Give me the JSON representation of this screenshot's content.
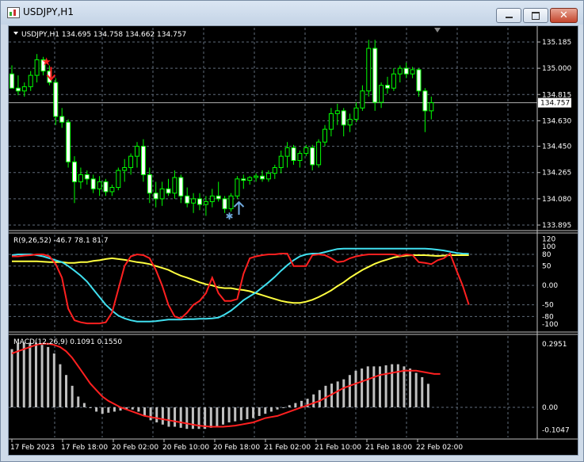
{
  "window": {
    "title": "USDJPY,H1"
  },
  "colors": {
    "bull": "#00ff00",
    "bear": "#00ff00",
    "grid": "#5f6b7a",
    "rsi_red": "#ff2020",
    "rsi_cyan": "#40e0f0",
    "rsi_yellow": "#ffff40",
    "macd_bar": "#c0c0c0",
    "macd_signal": "#ff2020",
    "arrow_sell": "#ff2020",
    "arrow_buy": "#6fa8dc",
    "price_tag_bg": "#ffffff"
  },
  "main_chart": {
    "header": "USDJPY,H1  134.695 134.758 134.662 134.757",
    "current_price": "134.757",
    "price_axis": [
      "135.185",
      "135.000",
      "134.815",
      "134.630",
      "134.450",
      "134.265",
      "134.080",
      "133.895"
    ],
    "price_range": [
      133.895,
      135.185
    ],
    "candles": [
      [
        134.96,
        135.02,
        134.9,
        134.86
      ],
      [
        134.86,
        134.95,
        134.81,
        134.84
      ],
      [
        134.84,
        134.9,
        134.8,
        134.87
      ],
      [
        134.87,
        134.98,
        134.84,
        134.95
      ],
      [
        134.95,
        135.1,
        134.9,
        135.06
      ],
      [
        135.06,
        135.08,
        134.95,
        134.98
      ],
      [
        134.98,
        135.02,
        134.88,
        134.9
      ],
      [
        134.9,
        134.93,
        134.6,
        134.66
      ],
      [
        134.66,
        134.72,
        134.58,
        134.62
      ],
      [
        134.62,
        134.64,
        134.3,
        134.34
      ],
      [
        134.34,
        134.38,
        134.05,
        134.2
      ],
      [
        134.2,
        134.3,
        134.15,
        134.25
      ],
      [
        134.25,
        134.28,
        134.18,
        134.22
      ],
      [
        134.22,
        134.25,
        134.12,
        134.15
      ],
      [
        134.15,
        134.24,
        134.1,
        134.2
      ],
      [
        134.2,
        134.22,
        134.1,
        134.13
      ],
      [
        134.13,
        134.18,
        134.1,
        134.16
      ],
      [
        134.16,
        134.3,
        134.14,
        134.28
      ],
      [
        134.28,
        134.36,
        134.2,
        134.3
      ],
      [
        134.3,
        134.4,
        134.25,
        134.38
      ],
      [
        134.38,
        134.48,
        134.3,
        134.45
      ],
      [
        134.45,
        134.5,
        134.2,
        134.25
      ],
      [
        134.25,
        134.3,
        134.05,
        134.12
      ],
      [
        134.12,
        134.2,
        134.02,
        134.08
      ],
      [
        134.08,
        134.2,
        134.03,
        134.15
      ],
      [
        134.15,
        134.22,
        134.1,
        134.12
      ],
      [
        134.12,
        134.28,
        134.08,
        134.23
      ],
      [
        134.23,
        134.25,
        134.05,
        134.1
      ],
      [
        134.1,
        134.16,
        134.02,
        134.05
      ],
      [
        134.05,
        134.12,
        133.98,
        134.08
      ],
      [
        134.08,
        134.12,
        134.0,
        134.04
      ],
      [
        134.04,
        134.1,
        133.96,
        134.06
      ],
      [
        134.06,
        134.15,
        134.02,
        134.1
      ],
      [
        134.1,
        134.2,
        134.06,
        134.08
      ],
      [
        134.08,
        134.1,
        133.98,
        134.01
      ],
      [
        134.01,
        134.12,
        133.99,
        134.1
      ],
      [
        134.1,
        134.24,
        134.08,
        134.22
      ],
      [
        134.22,
        134.25,
        134.15,
        134.21
      ],
      [
        134.21,
        134.24,
        134.18,
        134.23
      ],
      [
        134.23,
        134.26,
        134.2,
        134.24
      ],
      [
        134.24,
        134.28,
        134.2,
        134.22
      ],
      [
        134.22,
        134.28,
        134.2,
        134.26
      ],
      [
        134.26,
        134.32,
        134.22,
        134.3
      ],
      [
        134.3,
        134.42,
        134.26,
        134.38
      ],
      [
        134.38,
        134.48,
        134.3,
        134.44
      ],
      [
        134.44,
        134.46,
        134.32,
        134.35
      ],
      [
        134.35,
        134.42,
        134.3,
        134.4
      ],
      [
        134.4,
        134.46,
        134.38,
        134.44
      ],
      [
        134.44,
        134.46,
        134.28,
        134.32
      ],
      [
        134.32,
        134.5,
        134.3,
        134.48
      ],
      [
        134.48,
        134.6,
        134.45,
        134.57
      ],
      [
        134.57,
        134.72,
        134.52,
        134.68
      ],
      [
        134.68,
        134.75,
        134.6,
        134.7
      ],
      [
        134.7,
        134.72,
        134.52,
        134.6
      ],
      [
        134.6,
        134.68,
        134.55,
        134.64
      ],
      [
        134.64,
        134.76,
        134.62,
        134.72
      ],
      [
        134.72,
        134.88,
        134.7,
        134.84
      ],
      [
        134.84,
        135.2,
        134.8,
        135.14
      ],
      [
        135.14,
        135.2,
        134.7,
        134.76
      ],
      [
        134.76,
        134.9,
        134.72,
        134.88
      ],
      [
        134.88,
        134.94,
        134.82,
        134.86
      ],
      [
        134.86,
        135.0,
        134.84,
        134.96
      ],
      [
        134.96,
        135.02,
        134.9,
        135.0
      ],
      [
        135.0,
        135.04,
        134.93,
        134.96
      ],
      [
        134.96,
        135.01,
        134.93,
        134.99
      ],
      [
        134.99,
        135.0,
        134.8,
        134.84
      ],
      [
        134.84,
        134.86,
        134.55,
        134.7
      ],
      [
        134.7,
        134.8,
        134.64,
        134.757
      ]
    ],
    "sell_markers": [
      6
    ],
    "buy_markers": [
      35
    ],
    "time_axis": [
      "17 Feb 2023",
      "17 Feb 18:00",
      "20 Feb 02:00",
      "20 Feb 10:00",
      "20 Feb 18:00",
      "21 Feb 02:00",
      "21 Feb 10:00",
      "21 Feb 18:00",
      "22 Feb 02:00"
    ]
  },
  "rsi_panel": {
    "header": "R(9,26,52) -46.7 78.1 81.7",
    "axis": [
      "120",
      "100",
      "80",
      "50",
      "0.00",
      "-50",
      "-80",
      "-100"
    ],
    "range": [
      -110,
      125
    ],
    "red": [
      75,
      75,
      77,
      78,
      80,
      80,
      75,
      55,
      20,
      -60,
      -90,
      -95,
      -98,
      -98,
      -98,
      -95,
      -70,
      -10,
      50,
      75,
      80,
      78,
      70,
      40,
      0,
      -50,
      -80,
      -85,
      -70,
      -50,
      -40,
      -20,
      20,
      -20,
      -40,
      -40,
      -35,
      30,
      70,
      75,
      78,
      80,
      80,
      82,
      82,
      50,
      50,
      50,
      78,
      80,
      78,
      70,
      60,
      62,
      70,
      75,
      78,
      80,
      80,
      80,
      80,
      80,
      76,
      80,
      78,
      60,
      58,
      55,
      65,
      70,
      82,
      40,
      0,
      -50
    ],
    "cyan": [
      78,
      80,
      80,
      80,
      78,
      75,
      70,
      65,
      60,
      50,
      38,
      25,
      10,
      -10,
      -30,
      -50,
      -65,
      -78,
      -85,
      -90,
      -93,
      -93,
      -93,
      -92,
      -90,
      -88,
      -88,
      -88,
      -87,
      -87,
      -86,
      -86,
      -85,
      -83,
      -75,
      -65,
      -52,
      -38,
      -28,
      -18,
      -5,
      8,
      22,
      38,
      52,
      65,
      75,
      80,
      82,
      82,
      86,
      90,
      94,
      95,
      95,
      95,
      95,
      95,
      95,
      95,
      95,
      95,
      95,
      95,
      95,
      95,
      95,
      94,
      92,
      90,
      87,
      84,
      82,
      81.7
    ],
    "yellow": [
      62,
      62,
      62,
      62,
      62,
      61,
      60,
      60,
      60,
      58,
      58,
      60,
      60,
      63,
      65,
      68,
      70,
      68,
      66,
      63,
      60,
      58,
      55,
      50,
      45,
      40,
      32,
      25,
      20,
      14,
      8,
      3,
      0,
      -5,
      -7,
      -7,
      -10,
      -12,
      -15,
      -20,
      -25,
      -30,
      -35,
      -40,
      -43,
      -45,
      -45,
      -42,
      -37,
      -30,
      -22,
      -13,
      -2,
      8,
      20,
      30,
      40,
      48,
      56,
      62,
      67,
      72,
      75,
      77,
      78,
      78,
      78,
      77,
      76,
      77,
      78,
      78.1,
      78.1,
      78.1
    ]
  },
  "macd_panel": {
    "header": "MACD(12,26,9) 0.1091 0.1550",
    "axis": [
      "0.2951",
      "0.00",
      "-0.1047"
    ],
    "range": [
      -0.125,
      0.32
    ],
    "histogram": [
      0.27,
      0.3,
      0.3,
      0.3,
      0.3,
      0.29,
      0.28,
      0.25,
      0.2,
      0.15,
      0.1,
      0.05,
      0.02,
      0.0,
      -0.02,
      -0.03,
      -0.025,
      -0.02,
      -0.015,
      -0.01,
      -0.01,
      -0.02,
      -0.04,
      -0.06,
      -0.07,
      -0.08,
      -0.09,
      -0.09,
      -0.095,
      -0.1,
      -0.1,
      -0.1,
      -0.1,
      -0.095,
      -0.09,
      -0.08,
      -0.07,
      -0.065,
      -0.06,
      -0.055,
      -0.05,
      -0.04,
      -0.03,
      -0.02,
      -0.01,
      0.0,
      0.01,
      0.02,
      0.03,
      0.04,
      0.06,
      0.08,
      0.1,
      0.11,
      0.12,
      0.13,
      0.15,
      0.17,
      0.18,
      0.19,
      0.19,
      0.19,
      0.195,
      0.2,
      0.2,
      0.19,
      0.18,
      0.16,
      0.14,
      0.1091
    ],
    "signal": [
      0.25,
      0.26,
      0.27,
      0.28,
      0.29,
      0.295,
      0.295,
      0.29,
      0.28,
      0.26,
      0.23,
      0.19,
      0.15,
      0.11,
      0.08,
      0.05,
      0.03,
      0.015,
      0.0,
      -0.01,
      -0.02,
      -0.03,
      -0.04,
      -0.045,
      -0.05,
      -0.055,
      -0.06,
      -0.065,
      -0.07,
      -0.075,
      -0.08,
      -0.085,
      -0.088,
      -0.09,
      -0.09,
      -0.09,
      -0.088,
      -0.085,
      -0.08,
      -0.075,
      -0.07,
      -0.06,
      -0.05,
      -0.045,
      -0.04,
      -0.03,
      -0.02,
      -0.01,
      0.0,
      0.01,
      0.02,
      0.03,
      0.045,
      0.06,
      0.075,
      0.09,
      0.1,
      0.11,
      0.12,
      0.13,
      0.14,
      0.15,
      0.155,
      0.16,
      0.165,
      0.17,
      0.17,
      0.17,
      0.165,
      0.16,
      0.155,
      0.155
    ]
  }
}
